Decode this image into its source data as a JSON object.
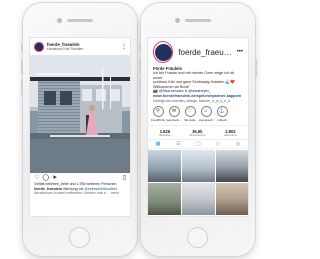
{
  "feed_post": {
    "username": "foerde_fraeulein",
    "location": "Hausboot Kiel Sechlen",
    "likes": "Gefällt belieben_belle und 1.955 weiteren Personen",
    "caption_user": "foerde_fraeulein",
    "caption_text": "Werbung mit",
    "caption_mention": "@seinwellerbootfest",
    "caption_tail": "Anreihsions in weel entfernten Ländern war e…  mehr",
    "icons": [
      "heart-icon",
      "comment-icon",
      "send-icon",
      "bookmark-icon"
    ]
  },
  "profile": {
    "username": "foerde_fraeu…",
    "more": "•••",
    "display_name": "Förde Fräulein",
    "bio_lines": [
      "Ich bin Frauke und mit meiner Crew zeige ich dir unser",
      "schönes Kiel und ganz Schleswig-Holstein 🌊❤️",
      "Willkommen an Bord!",
      "📷 @frisa.schulze & @smaheyer_",
      "www.foerdefraeulein.de/speicherpartner-kappeln"
    ],
    "followed_by": "Gefolgt von morden_design, banner_e_a_s_e_n",
    "highlights": [
      "Food/Drink",
      "Geschenk…",
      "SH Liebe",
      "Hometouch",
      "Lübeck"
    ],
    "highlight_icons": [
      "fork-knife-icon",
      "gift-icon",
      "heart-icon",
      "home-icon",
      "anchor-icon"
    ],
    "stats": [
      {
        "value": "1.826",
        "label": "Beiträge"
      },
      {
        "value": "36,5k",
        "label": "Abonnenten"
      },
      {
        "value": "1.802",
        "label": "abonniert"
      }
    ],
    "tabs": [
      "grid-icon",
      "list-icon",
      "igtv-icon",
      "reels-icon",
      "tagged-icon"
    ]
  }
}
